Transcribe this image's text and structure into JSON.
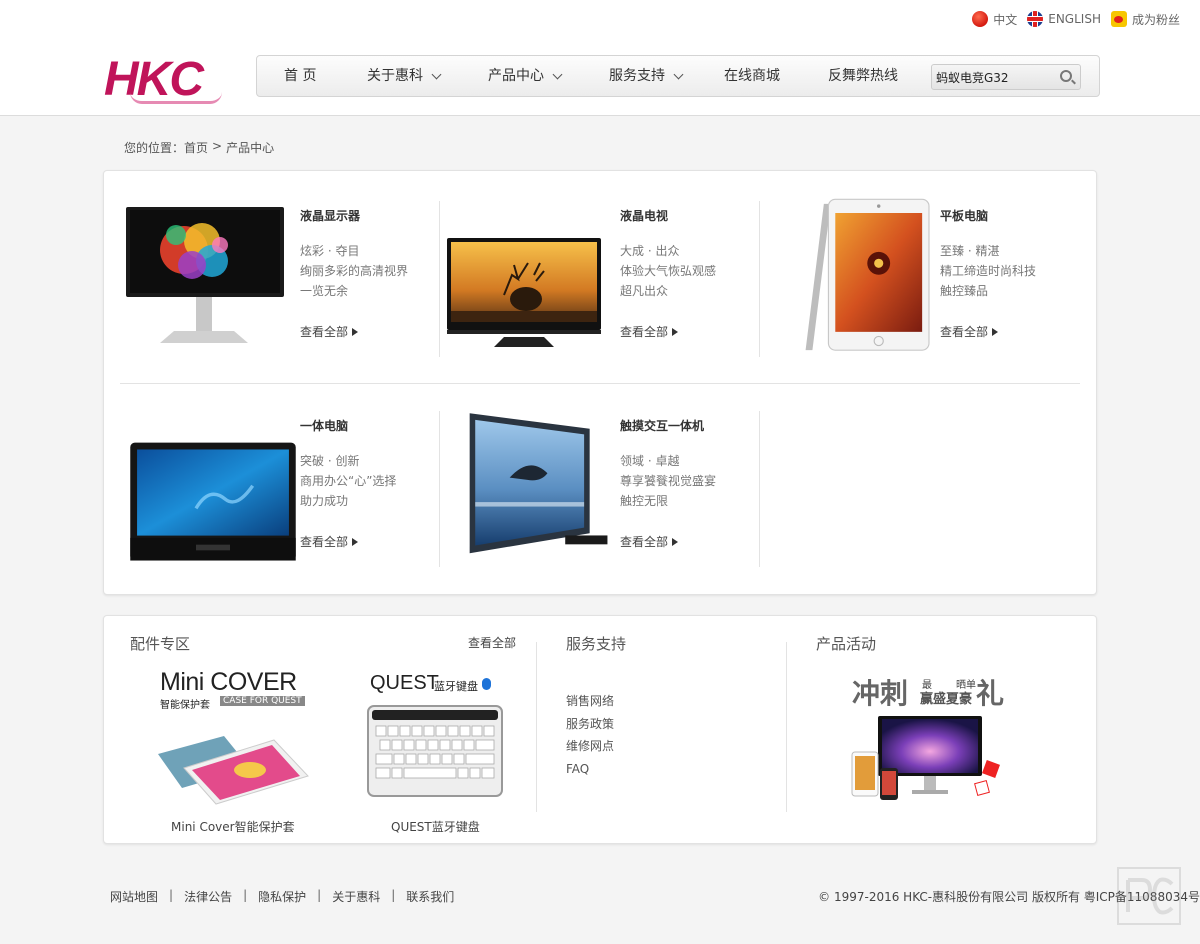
{
  "topbar": {
    "lang_cn": "中文",
    "lang_en": "ENGLISH",
    "fans": "成为粉丝"
  },
  "logo": {
    "text": "HKC",
    "color": "#c0145a"
  },
  "nav": {
    "items": [
      {
        "label": "首 页",
        "dropdown": false
      },
      {
        "label": "关于惠科",
        "dropdown": true
      },
      {
        "label": "产品中心",
        "dropdown": true
      },
      {
        "label": "服务支持",
        "dropdown": true
      },
      {
        "label": "在线商城",
        "dropdown": false
      },
      {
        "label": "反舞弊热线",
        "dropdown": false
      }
    ],
    "search_value": "蚂蚁电竞G32"
  },
  "breadcrumb": {
    "prefix": "您的位置：",
    "home": "首页",
    "separator": ">",
    "current": "产品中心"
  },
  "products": [
    {
      "title": "液晶显示器",
      "lines": [
        "炫彩 · 夺目",
        "绚丽多彩的高清视界",
        "一览无余"
      ],
      "more": "查看全部"
    },
    {
      "title": "液晶电视",
      "lines": [
        "大成 · 出众",
        "体验大气恢弘观感",
        "超凡出众"
      ],
      "more": "查看全部"
    },
    {
      "title": "平板电脑",
      "lines": [
        "至臻 · 精湛",
        "精工缔造时尚科技",
        "触控臻品"
      ],
      "more": "查看全部"
    },
    {
      "title": "一体电脑",
      "lines": [
        "突破 · 创新",
        "商用办公“心”选择",
        "助力成功"
      ],
      "more": "查看全部"
    },
    {
      "title": "触摸交互一体机",
      "lines": [
        "领域 · 卓越",
        "尊享饕餮视觉盛宴",
        "触控无限"
      ],
      "more": "查看全部"
    }
  ],
  "accessories": {
    "title": "配件专区",
    "more": "查看全部",
    "items": [
      {
        "caption": "Mini Cover智能保护套",
        "banner_main": "Mini COVER",
        "banner_sub": "智能保护套",
        "banner_sub2": "CASE FOR QUEST"
      },
      {
        "caption": "QUEST蓝牙键盘",
        "banner_main": "QUEST",
        "banner_sub": "蓝牙键盘"
      }
    ]
  },
  "service": {
    "title": "服务支持",
    "links": [
      "销售网络",
      "服务政策",
      "维修网点",
      "FAQ"
    ]
  },
  "activity": {
    "title": "产品活动",
    "banner_main": "冲刺",
    "banner_mid1": "最",
    "banner_mid2": "晒单",
    "banner_sub": "赢盛夏豪",
    "banner_end": "礼"
  },
  "footer": {
    "links": [
      "网站地图",
      "法律公告",
      "隐私保护",
      "关于惠科",
      "联系我们"
    ],
    "separator": "|",
    "copyright": "© 1997-2016 HKC-惠科股份有限公司 版权所有 粤ICP备11088034号"
  },
  "colors": {
    "brand": "#c0145a",
    "page_bg": "#f4f4f4"
  }
}
